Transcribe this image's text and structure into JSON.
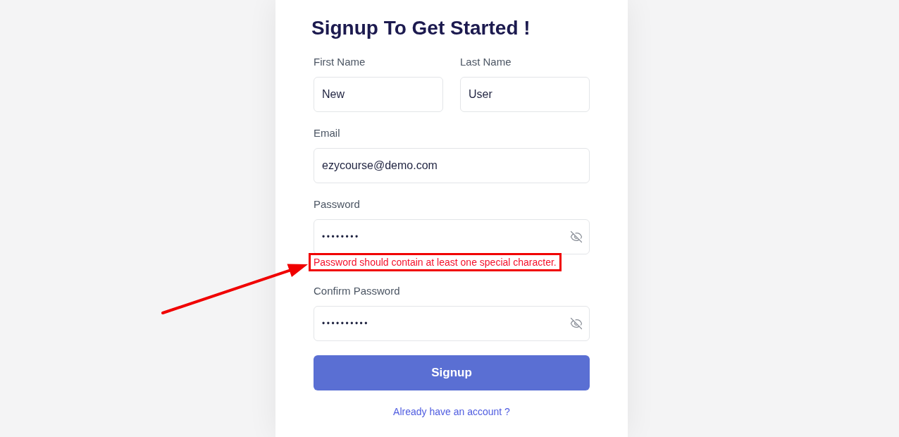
{
  "heading": "Signup To Get Started !",
  "name_row": [
    {
      "label": "First Name",
      "value": "New"
    },
    {
      "label": "Last Name",
      "value": "User"
    }
  ],
  "fields": [
    {
      "kind": "text",
      "label": "Email",
      "value": "ezycourse@demo.com"
    },
    {
      "kind": "password",
      "label": "Password",
      "value": "••••••••",
      "error": {
        "text": "Password should contain at least one special character.",
        "highlighted": true,
        "arrow": true
      }
    },
    {
      "kind": "password",
      "label": "Confirm Password",
      "value": "••••••••••"
    }
  ],
  "submit_button": "Signup",
  "login_link": "Already have an account ?"
}
